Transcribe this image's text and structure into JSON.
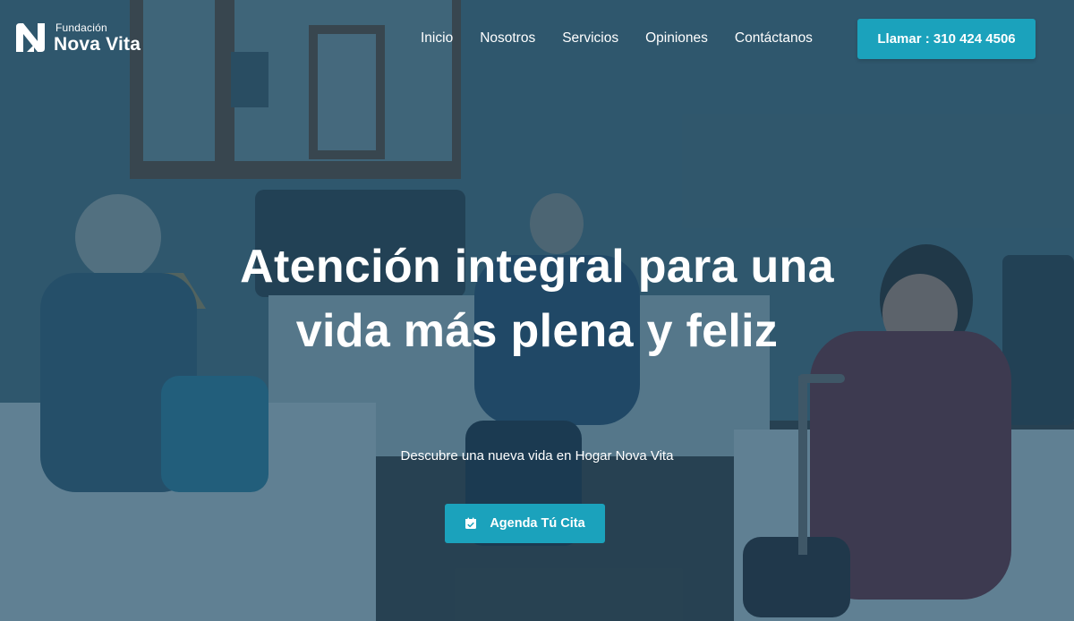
{
  "brand": {
    "small": "Fundación",
    "name": "Nova Vita"
  },
  "nav": {
    "items": [
      "Inicio",
      "Nosotros",
      "Servicios",
      "Opiniones",
      "Contáctanos"
    ],
    "call_label": "Llamar : 310 424 4506"
  },
  "hero": {
    "title": "Atención integral para una vida más plena y feliz",
    "subtitle": "Descubre una nueva vida en Hogar Nova Vita",
    "cta_label": "Agenda Tú Cita",
    "cta_icon": "calendar-icon"
  },
  "colors": {
    "accent": "#1ba2bc",
    "overlay": "#18445c",
    "text": "#ffffff"
  }
}
